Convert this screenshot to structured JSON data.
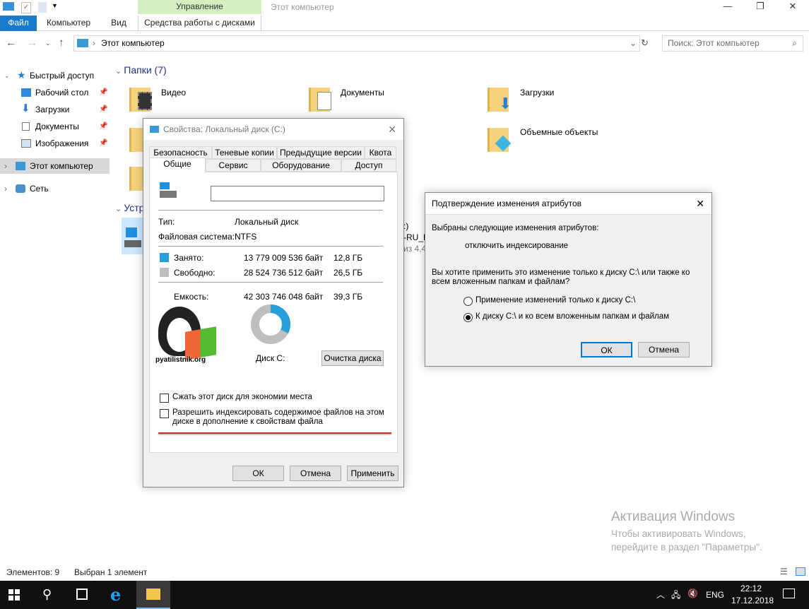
{
  "ribbon": {
    "manage_tab": "Управление",
    "window_title": "Этот компьютер",
    "tabs": [
      "Файл",
      "Компьютер",
      "Вид",
      "Средства работы с дисками"
    ]
  },
  "address": {
    "path": "Этот компьютер",
    "search_placeholder": "Поиск: Этот компьютер"
  },
  "sidebar": {
    "items": [
      {
        "label": "Быстрый доступ"
      },
      {
        "label": "Рабочий стол"
      },
      {
        "label": "Загрузки"
      },
      {
        "label": "Документы"
      },
      {
        "label": "Изображения"
      },
      {
        "label": "Этот компьютер"
      },
      {
        "label": "Сеть"
      }
    ]
  },
  "main": {
    "folders_header": "Папки (7)",
    "folders": [
      "Видео",
      "Документы",
      "Загрузки",
      "Объемные объекты"
    ],
    "devices_header": "Устр",
    "drive_partial": [
      ":)",
      "-RU_D",
      "из 4,4"
    ]
  },
  "props": {
    "title": "Свойства: Локальный диск (C:)",
    "tabs_row1": [
      "Безопасность",
      "Теневые копии",
      "Предыдущие версии",
      "Квота"
    ],
    "tabs_row2": [
      "Общие",
      "Сервис",
      "Оборудование",
      "Доступ"
    ],
    "name_value": "",
    "type_label": "Тип:",
    "type_value": "Локальный диск",
    "fs_label": "Файловая система:",
    "fs_value": "NTFS",
    "used_label": "Занято:",
    "used_bytes": "13 779 009 536 байт",
    "used_gb": "12,8 ГБ",
    "free_label": "Свободно:",
    "free_bytes": "28 524 736 512 байт",
    "free_gb": "26,5 ГБ",
    "cap_label": "Емкость:",
    "cap_bytes": "42 303 746 048 байт",
    "cap_gb": "39,3 ГБ",
    "used_fraction": 0.326,
    "disk_label": "Диск С:",
    "cleanup": "Очистка диска",
    "compress": "Сжать этот диск для экономии места",
    "index": "Разрешить индексировать содержимое файлов на этом диске в дополнение к свойствам файла",
    "ok": "ОК",
    "cancel": "Отмена",
    "apply": "Применить",
    "used_color": "#26a0da",
    "free_color": "#bfbfbf",
    "watermark": "pyatilistnik.org"
  },
  "confirm": {
    "title": "Подтверждение изменения атрибутов",
    "line1": "Выбраны следующие изменения атрибутов:",
    "change": "отключить индексирование",
    "question": "Вы хотите применить это изменение только к диску C:\\ или также ко всем вложенным папкам и файлам?",
    "opt1": "Применение изменений только к диску C:\\",
    "opt2": "К диску C:\\ и ко всем вложенным папкам и файлам",
    "ok": "ОК",
    "cancel": "Отмена"
  },
  "activation": {
    "title": "Активация Windows",
    "line1": "Чтобы активировать Windows,",
    "line2": "перейдите в раздел \"Параметры\"."
  },
  "status": {
    "count": "Элементов: 9",
    "selected": "Выбран 1 элемент"
  },
  "taskbar": {
    "lang": "ENG",
    "time": "22:12",
    "date": "17.12.2018"
  }
}
